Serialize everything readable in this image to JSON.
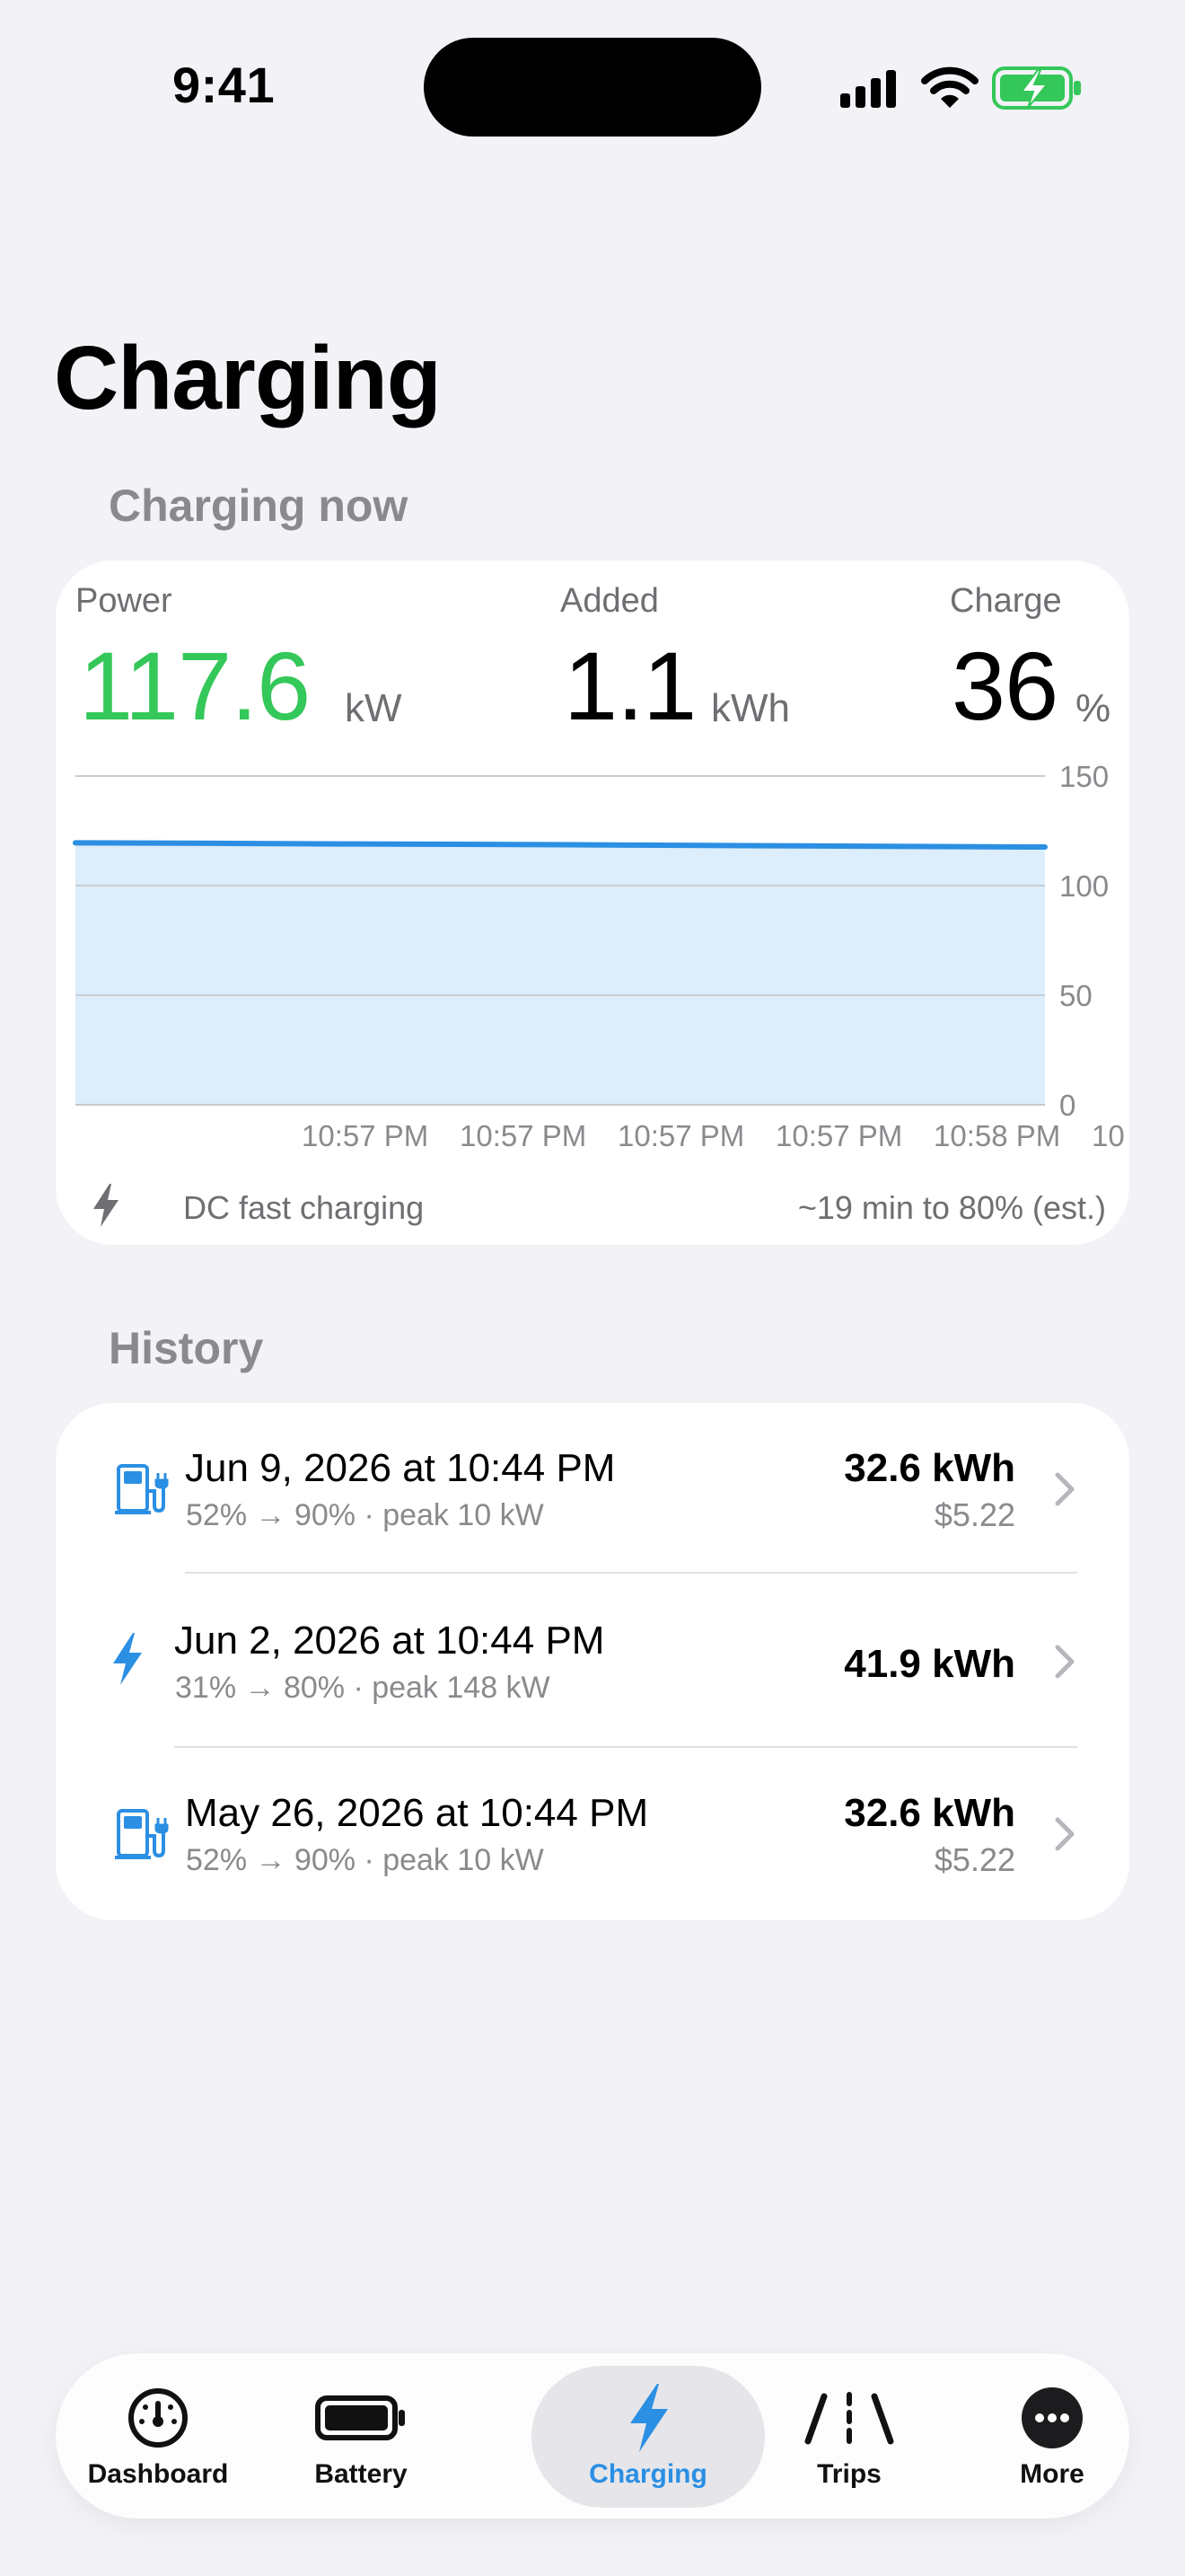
{
  "status_bar": {
    "time": "9:41"
  },
  "page": {
    "title": "Charging"
  },
  "charging_now": {
    "header": "Charging now",
    "power": {
      "label": "Power",
      "value": "117.6",
      "unit": "kW",
      "color": "#34c759"
    },
    "added": {
      "label": "Added",
      "value": "1.1",
      "unit": "kWh"
    },
    "charge": {
      "label": "Charge",
      "value": "36",
      "unit": "%"
    },
    "mode_text": "DC fast charging",
    "estimate_text": "~19 min to 80% (est.)",
    "chart_data": {
      "type": "area",
      "x_tick_labels": [
        "10:57 PM",
        "10:57 PM",
        "10:57 PM",
        "10:57 PM",
        "10:58 PM",
        "10"
      ],
      "y_ticks": [
        0,
        50,
        100,
        150
      ],
      "ylim": [
        0,
        150
      ],
      "series": [
        {
          "values": [
            119.5,
            119.3,
            119.0,
            118.8,
            118.5,
            118.2,
            117.9,
            117.6
          ]
        }
      ],
      "line_color": "#2b8fe3",
      "fill_color": "#dcedfb",
      "grid": true
    }
  },
  "history": {
    "header": "History",
    "items": [
      {
        "icon": "fuel-pump-icon",
        "title": "Jun 9, 2026 at 10:44 PM",
        "subtitle": "52% → 90%  ·  peak 10 kW",
        "energy": "32.6 kWh",
        "cost": "$5.22"
      },
      {
        "icon": "bolt-icon",
        "title": "Jun 2, 2026 at 10:44 PM",
        "subtitle": "31% → 80%  ·  peak 148 kW",
        "energy": "41.9 kWh",
        "cost": ""
      },
      {
        "icon": "fuel-pump-icon",
        "title": "May 26, 2026 at 10:44 PM",
        "subtitle": "52% → 90%  ·  peak 10 kW",
        "energy": "32.6 kWh",
        "cost": "$5.22"
      }
    ]
  },
  "tabbar": {
    "active": "Charging",
    "active_color": "#2b8fe3",
    "tabs": [
      {
        "label": "Dashboard",
        "icon": "speedometer-icon"
      },
      {
        "label": "Battery",
        "icon": "battery-icon"
      },
      {
        "label": "Charging",
        "icon": "bolt-icon"
      },
      {
        "label": "Trips",
        "icon": "road-icon"
      },
      {
        "label": "More",
        "icon": "more-icon"
      }
    ]
  }
}
